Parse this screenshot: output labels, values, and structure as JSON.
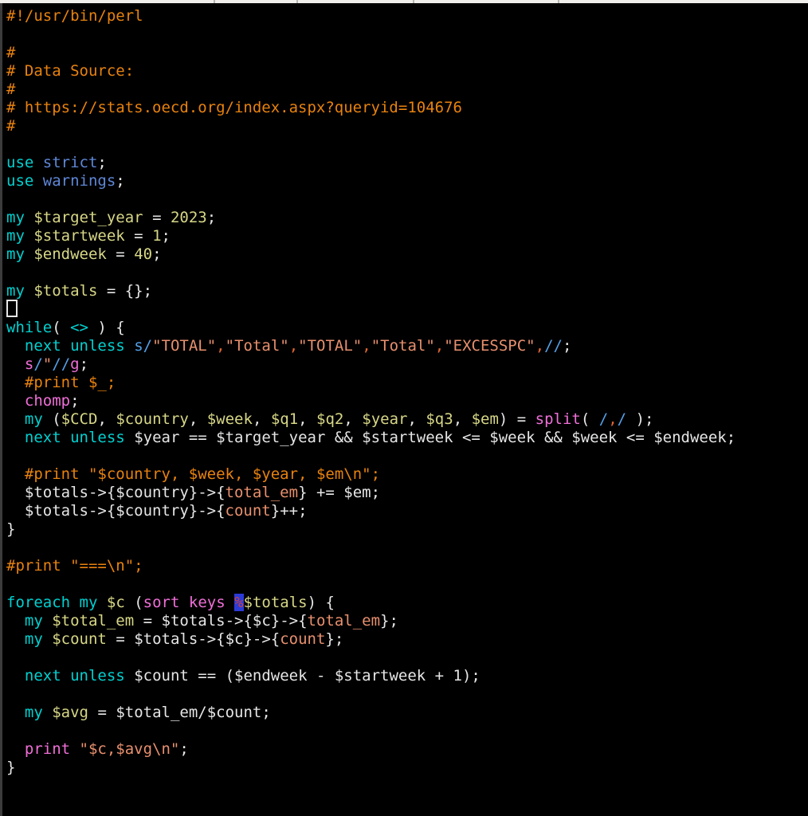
{
  "app": "terminal-vim-perl-editor",
  "palette": {
    "background": "#000000",
    "comment": "#e8820e",
    "keyword": "#00d1d1",
    "module": "#5f87d7",
    "variable_decl": "#d7d787",
    "number": "#d7d787",
    "plain": "#e6e6e6",
    "string": "#e8906e",
    "regex_comma": "#e0662f",
    "regex_delim": "#55a0e8",
    "builtin": "#f06fd8",
    "percent_highlight_fg": "#d04040",
    "percent_highlight_bg": "#2b3bd6",
    "top_strip": "#f0efeb",
    "left_edge": "#3c3c3c"
  },
  "top_strip_ticks_x": [
    268,
    372,
    518,
    700
  ],
  "code": {
    "language": "perl",
    "lines": [
      {
        "segs": [
          [
            "c",
            "#!/usr/bin/perl"
          ]
        ]
      },
      {
        "segs": []
      },
      {
        "segs": [
          [
            "c",
            "#"
          ]
        ]
      },
      {
        "segs": [
          [
            "c",
            "# Data Source:"
          ]
        ]
      },
      {
        "segs": [
          [
            "c",
            "#"
          ]
        ]
      },
      {
        "segs": [
          [
            "c",
            "# https://stats.oecd.org/index.aspx?queryid=104676"
          ]
        ]
      },
      {
        "segs": [
          [
            "c",
            "#"
          ]
        ]
      },
      {
        "segs": []
      },
      {
        "segs": [
          [
            "k",
            "use"
          ],
          [
            "p",
            " "
          ],
          [
            "m",
            "strict"
          ],
          [
            "p",
            ";"
          ]
        ]
      },
      {
        "segs": [
          [
            "k",
            "use"
          ],
          [
            "p",
            " "
          ],
          [
            "m",
            "warnings"
          ],
          [
            "p",
            ";"
          ]
        ]
      },
      {
        "segs": []
      },
      {
        "segs": [
          [
            "k",
            "my"
          ],
          [
            "p",
            " "
          ],
          [
            "v",
            "$target_year"
          ],
          [
            "p",
            " = "
          ],
          [
            "v",
            "2023"
          ],
          [
            "p",
            ";"
          ]
        ]
      },
      {
        "segs": [
          [
            "k",
            "my"
          ],
          [
            "p",
            " "
          ],
          [
            "v",
            "$startweek"
          ],
          [
            "p",
            " = "
          ],
          [
            "v",
            "1"
          ],
          [
            "p",
            ";"
          ]
        ]
      },
      {
        "segs": [
          [
            "k",
            "my"
          ],
          [
            "p",
            " "
          ],
          [
            "v",
            "$endweek"
          ],
          [
            "p",
            " = "
          ],
          [
            "v",
            "40"
          ],
          [
            "p",
            ";"
          ]
        ]
      },
      {
        "segs": []
      },
      {
        "segs": [
          [
            "k",
            "my"
          ],
          [
            "p",
            " "
          ],
          [
            "v",
            "$totals"
          ],
          [
            "p",
            " = {};"
          ]
        ]
      },
      {
        "segs": [],
        "cursor": true
      },
      {
        "segs": [
          [
            "k",
            "while"
          ],
          [
            "p",
            "( "
          ],
          [
            "k",
            "<>"
          ],
          [
            "p",
            " ) {"
          ]
        ]
      },
      {
        "segs": [
          [
            "p",
            "  "
          ],
          [
            "k",
            "next"
          ],
          [
            "p",
            " "
          ],
          [
            "k",
            "unless"
          ],
          [
            "p",
            " "
          ],
          [
            "b",
            "s/"
          ],
          [
            "s",
            "\"TOTAL\""
          ],
          [
            "o",
            ","
          ],
          [
            "s",
            "\"Total\""
          ],
          [
            "o",
            ","
          ],
          [
            "s",
            "\"TOTAL\""
          ],
          [
            "o",
            ","
          ],
          [
            "s",
            "\"Total\""
          ],
          [
            "o",
            ","
          ],
          [
            "s",
            "\"EXCESSPC\""
          ],
          [
            "o",
            ","
          ],
          [
            "b",
            "//"
          ],
          [
            "p",
            ";"
          ]
        ]
      },
      {
        "segs": [
          [
            "p",
            "  "
          ],
          [
            "f",
            "s"
          ],
          [
            "b",
            "/"
          ],
          [
            "s",
            "\""
          ],
          [
            "b",
            "//"
          ],
          [
            "f",
            "g"
          ],
          [
            "p",
            ";"
          ]
        ]
      },
      {
        "segs": [
          [
            "p",
            "  "
          ],
          [
            "c",
            "#print $_;"
          ]
        ]
      },
      {
        "segs": [
          [
            "p",
            "  "
          ],
          [
            "f",
            "chomp"
          ],
          [
            "p",
            ";"
          ]
        ]
      },
      {
        "segs": [
          [
            "p",
            "  "
          ],
          [
            "k",
            "my"
          ],
          [
            "p",
            " ("
          ],
          [
            "v",
            "$CCD"
          ],
          [
            "p",
            ", "
          ],
          [
            "v",
            "$country"
          ],
          [
            "p",
            ", "
          ],
          [
            "v",
            "$week"
          ],
          [
            "p",
            ", "
          ],
          [
            "v",
            "$q1"
          ],
          [
            "p",
            ", "
          ],
          [
            "v",
            "$q2"
          ],
          [
            "p",
            ", "
          ],
          [
            "v",
            "$year"
          ],
          [
            "p",
            ", "
          ],
          [
            "v",
            "$q3"
          ],
          [
            "p",
            ", "
          ],
          [
            "v",
            "$em"
          ],
          [
            "p",
            ") = "
          ],
          [
            "f",
            "split"
          ],
          [
            "p",
            "( "
          ],
          [
            "b",
            "/"
          ],
          [
            "o",
            ","
          ],
          [
            "b",
            "/"
          ],
          [
            "p",
            " );"
          ]
        ]
      },
      {
        "segs": [
          [
            "p",
            "  "
          ],
          [
            "k",
            "next"
          ],
          [
            "p",
            " "
          ],
          [
            "k",
            "unless"
          ],
          [
            "p",
            " $year == $target_year && $startweek <= $week && $week <= $endweek;"
          ]
        ]
      },
      {
        "segs": []
      },
      {
        "segs": [
          [
            "p",
            "  "
          ],
          [
            "c",
            "#print \"$country, $week, $year, $em\\n\";"
          ]
        ]
      },
      {
        "segs": [
          [
            "p",
            "  $totals->{$country}->{"
          ],
          [
            "s",
            "total_em"
          ],
          [
            "p",
            "} += $em;"
          ]
        ]
      },
      {
        "segs": [
          [
            "p",
            "  $totals->{$country}->{"
          ],
          [
            "s",
            "count"
          ],
          [
            "p",
            "}++;"
          ]
        ]
      },
      {
        "segs": [
          [
            "p",
            "}"
          ]
        ]
      },
      {
        "segs": []
      },
      {
        "segs": [
          [
            "c",
            "#print \"===\\n\";"
          ]
        ]
      },
      {
        "segs": []
      },
      {
        "segs": [
          [
            "k",
            "foreach"
          ],
          [
            "p",
            " "
          ],
          [
            "k",
            "my"
          ],
          [
            "p",
            " "
          ],
          [
            "v",
            "$c"
          ],
          [
            "p",
            " ("
          ],
          [
            "f",
            "sort"
          ],
          [
            "p",
            " "
          ],
          [
            "f",
            "keys"
          ],
          [
            "p",
            " "
          ],
          [
            "hl",
            "%"
          ],
          [
            "v",
            "$totals"
          ],
          [
            "p",
            ") {"
          ]
        ]
      },
      {
        "segs": [
          [
            "p",
            "  "
          ],
          [
            "k",
            "my"
          ],
          [
            "p",
            " "
          ],
          [
            "v",
            "$total_em"
          ],
          [
            "p",
            " = $totals->{$c}->{"
          ],
          [
            "s",
            "total_em"
          ],
          [
            "p",
            "};"
          ]
        ]
      },
      {
        "segs": [
          [
            "p",
            "  "
          ],
          [
            "k",
            "my"
          ],
          [
            "p",
            " "
          ],
          [
            "v",
            "$count"
          ],
          [
            "p",
            " = $totals->{$c}->{"
          ],
          [
            "s",
            "count"
          ],
          [
            "p",
            "};"
          ]
        ]
      },
      {
        "segs": []
      },
      {
        "segs": [
          [
            "p",
            "  "
          ],
          [
            "k",
            "next"
          ],
          [
            "p",
            " "
          ],
          [
            "k",
            "unless"
          ],
          [
            "p",
            " $count == ($endweek - $startweek + 1);"
          ]
        ]
      },
      {
        "segs": []
      },
      {
        "segs": [
          [
            "p",
            "  "
          ],
          [
            "k",
            "my"
          ],
          [
            "p",
            " "
          ],
          [
            "v",
            "$avg"
          ],
          [
            "p",
            " = $total_em/$count;"
          ]
        ]
      },
      {
        "segs": []
      },
      {
        "segs": [
          [
            "p",
            "  "
          ],
          [
            "f",
            "print"
          ],
          [
            "p",
            " "
          ],
          [
            "s",
            "\"$c,$avg\\n\""
          ],
          [
            "p",
            ";"
          ]
        ]
      },
      {
        "segs": [
          [
            "p",
            "}"
          ]
        ]
      }
    ]
  }
}
